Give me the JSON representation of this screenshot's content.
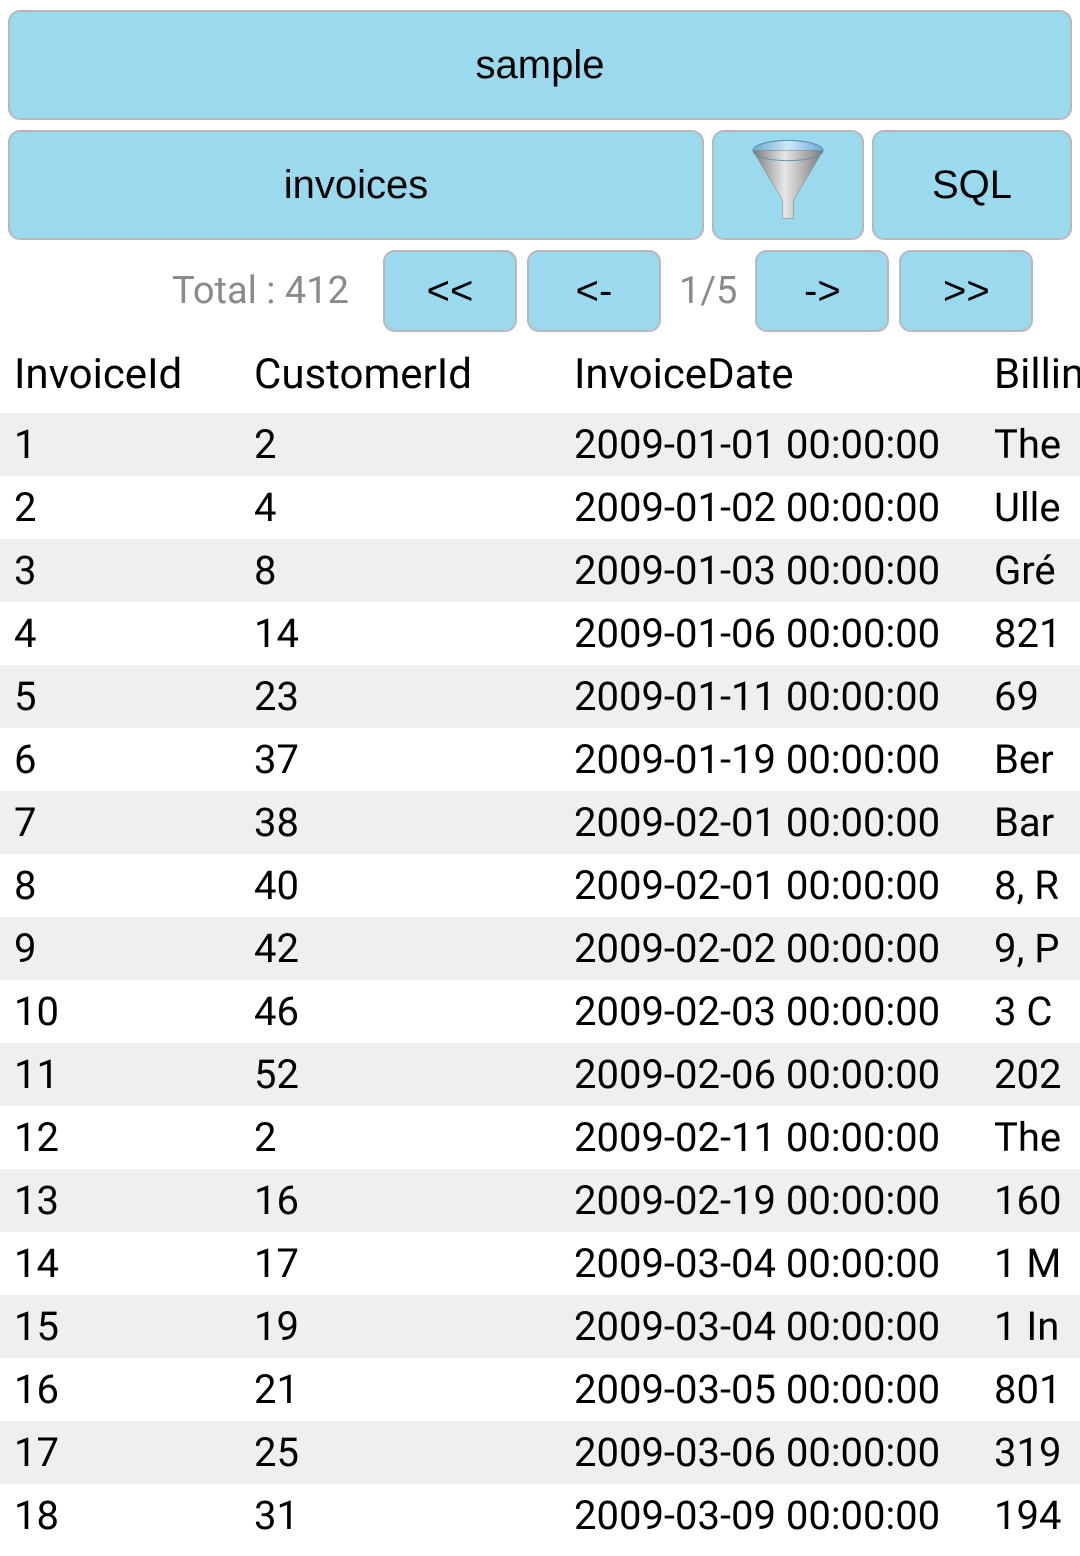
{
  "header": {
    "database_button_label": "sample",
    "table_button_label": "invoices",
    "filter_icon_name": "filter-funnel-icon",
    "sql_button_label": "SQL"
  },
  "pagination": {
    "total_label": "Total : 412",
    "first_label": "<<",
    "prev_label": "<-",
    "page_label": "1/5",
    "next_label": "->",
    "last_label": ">>"
  },
  "table": {
    "columns": [
      "InvoiceId",
      "CustomerId",
      "InvoiceDate",
      "BillingAddress"
    ],
    "column_display": [
      "InvoiceId",
      "CustomerId",
      "InvoiceDate",
      "Bil"
    ],
    "rows": [
      {
        "InvoiceId": "1",
        "CustomerId": "2",
        "InvoiceDate": "2009-01-01 00:00:00",
        "BillingAddress": "The"
      },
      {
        "InvoiceId": "2",
        "CustomerId": "4",
        "InvoiceDate": "2009-01-02 00:00:00",
        "BillingAddress": "Ulle"
      },
      {
        "InvoiceId": "3",
        "CustomerId": "8",
        "InvoiceDate": "2009-01-03 00:00:00",
        "BillingAddress": "Gré"
      },
      {
        "InvoiceId": "4",
        "CustomerId": "14",
        "InvoiceDate": "2009-01-06 00:00:00",
        "BillingAddress": "821"
      },
      {
        "InvoiceId": "5",
        "CustomerId": "23",
        "InvoiceDate": "2009-01-11 00:00:00",
        "BillingAddress": "69"
      },
      {
        "InvoiceId": "6",
        "CustomerId": "37",
        "InvoiceDate": "2009-01-19 00:00:00",
        "BillingAddress": "Ber"
      },
      {
        "InvoiceId": "7",
        "CustomerId": "38",
        "InvoiceDate": "2009-02-01 00:00:00",
        "BillingAddress": "Bar"
      },
      {
        "InvoiceId": "8",
        "CustomerId": "40",
        "InvoiceDate": "2009-02-01 00:00:00",
        "BillingAddress": "8, R"
      },
      {
        "InvoiceId": "9",
        "CustomerId": "42",
        "InvoiceDate": "2009-02-02 00:00:00",
        "BillingAddress": "9, P"
      },
      {
        "InvoiceId": "10",
        "CustomerId": "46",
        "InvoiceDate": "2009-02-03 00:00:00",
        "BillingAddress": "3 C"
      },
      {
        "InvoiceId": "11",
        "CustomerId": "52",
        "InvoiceDate": "2009-02-06 00:00:00",
        "BillingAddress": "202"
      },
      {
        "InvoiceId": "12",
        "CustomerId": "2",
        "InvoiceDate": "2009-02-11 00:00:00",
        "BillingAddress": "The"
      },
      {
        "InvoiceId": "13",
        "CustomerId": "16",
        "InvoiceDate": "2009-02-19 00:00:00",
        "BillingAddress": "160"
      },
      {
        "InvoiceId": "14",
        "CustomerId": "17",
        "InvoiceDate": "2009-03-04 00:00:00",
        "BillingAddress": "1 M"
      },
      {
        "InvoiceId": "15",
        "CustomerId": "19",
        "InvoiceDate": "2009-03-04 00:00:00",
        "BillingAddress": "1 In"
      },
      {
        "InvoiceId": "16",
        "CustomerId": "21",
        "InvoiceDate": "2009-03-05 00:00:00",
        "BillingAddress": "801"
      },
      {
        "InvoiceId": "17",
        "CustomerId": "25",
        "InvoiceDate": "2009-03-06 00:00:00",
        "BillingAddress": "319"
      },
      {
        "InvoiceId": "18",
        "CustomerId": "31",
        "InvoiceDate": "2009-03-09 00:00:00",
        "BillingAddress": "194"
      }
    ]
  }
}
